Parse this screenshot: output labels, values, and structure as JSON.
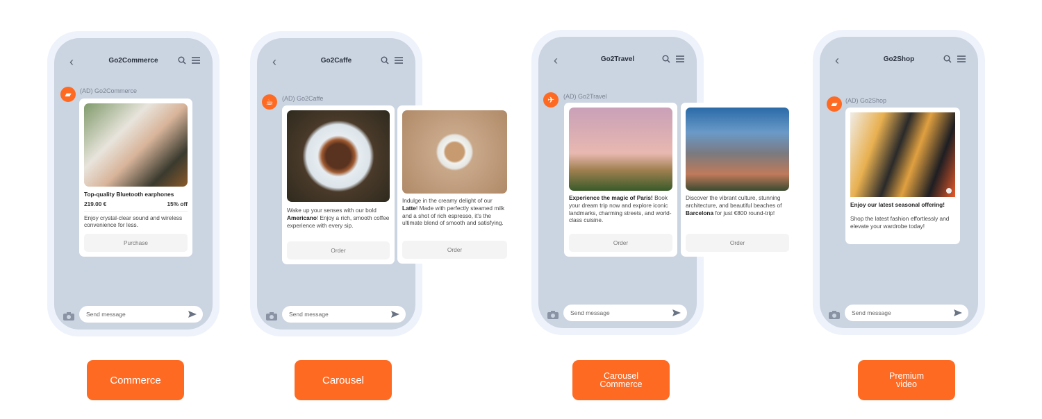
{
  "accent": "#FF6A22",
  "phones": [
    {
      "title": "Go2Commerce",
      "sender": "(AD) Go2Commerce",
      "avatar_icon": "shopping-bag-icon",
      "cards": [
        {
          "title": "Top-quality Bluetooth earphones",
          "price": "219.00 €",
          "discount": "15% off",
          "text": "Enjoy crystal-clear sound and wireless convenience for less.",
          "button": "Purchase"
        }
      ],
      "input_placeholder": "Send message",
      "type_label": "Commerce"
    },
    {
      "title": "Go2Caffe",
      "sender": "(AD) Go2Caffe",
      "avatar_icon": "coffee-cup-icon",
      "cards": [
        {
          "pre": "Wake up your senses with our bold ",
          "bold": "Americano",
          "post": "! Enjoy a rich, smooth coffee experience with every sip.",
          "button": "Order"
        },
        {
          "pre": "Indulge in the creamy delight of our ",
          "bold": "Latte",
          "post": "! Made with perfectly steamed milk and a shot of rich espresso, it's the ultimate blend of smooth and satisfying.",
          "button": "Order"
        }
      ],
      "input_placeholder": "Send message",
      "type_label": "Carousel"
    },
    {
      "title": "Go2Travel",
      "sender": "(AD) Go2Travel",
      "avatar_icon": "airplane-icon",
      "cards": [
        {
          "bold": "Experience the magic of Paris!",
          "post": " Book your dream trip now and explore iconic landmarks, charming streets, and world-class cuisine.",
          "button": "Order"
        },
        {
          "pre": "Discover the vibrant culture, stunning architecture, and beautiful beaches of ",
          "bold": "Barcelona",
          "post": " for just €800 round-trip!",
          "button": "Order"
        }
      ],
      "input_placeholder": "Send message",
      "type_label": "Carousel\nCommerce"
    },
    {
      "title": "Go2Shop",
      "sender": "(AD) Go2Shop",
      "avatar_icon": "shopping-bag-icon",
      "cards": [
        {
          "title": "Enjoy our latest seasonal offering!",
          "text": "Shop the latest fashion effortlessly and elevate your wardrobe today!"
        }
      ],
      "input_placeholder": "Send message",
      "type_label": "Premium\nvideo"
    }
  ]
}
